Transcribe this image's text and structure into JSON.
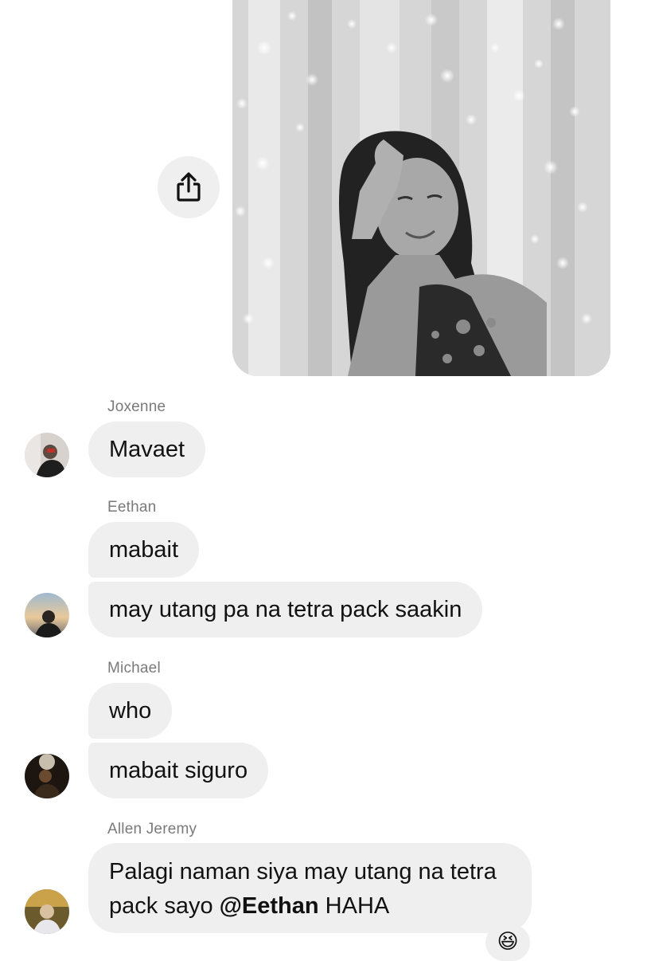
{
  "shared_post": {
    "image_alt": "black and white photo of a smiling woman in front of string lights and curtains",
    "share_icon": "share-icon"
  },
  "messages": [
    {
      "sender": "Joxenne",
      "bubbles": [
        "Mavaet"
      ]
    },
    {
      "sender": "Eethan",
      "bubbles": [
        "mabait",
        "may utang pa na tetra pack saakin"
      ]
    },
    {
      "sender": "Michael",
      "bubbles": [
        "who",
        "mabait siguro"
      ]
    },
    {
      "sender": "Allen Jeremy",
      "bubble_parts": {
        "before": "Palagi naman siya may utang na tetra pack sayo ",
        "mention": "@Eethan",
        "after": " HAHA"
      },
      "reaction": "😆"
    }
  ],
  "colors": {
    "bubble_bg": "#efefef",
    "sender_text": "#7a7a7a",
    "message_text": "#111111"
  }
}
